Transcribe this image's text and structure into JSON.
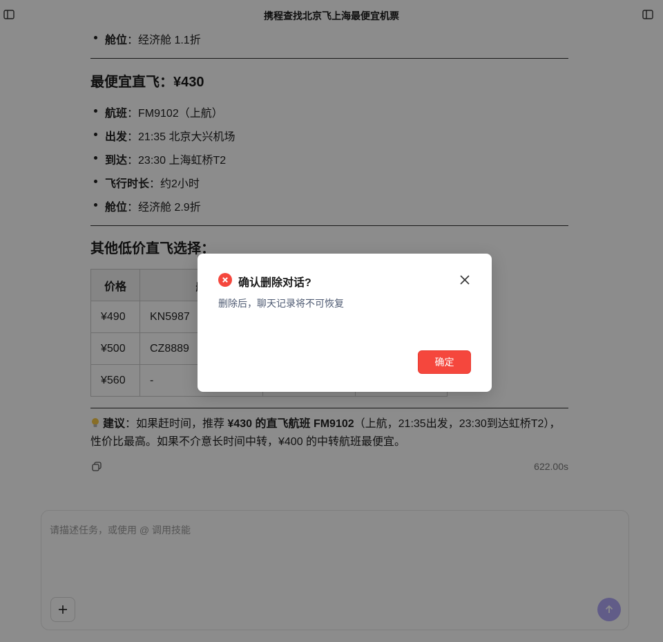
{
  "window": {
    "title": "携程查找北京飞上海最便宜机票",
    "left_icon": "sidebar-toggle-icon",
    "right_icon": "panel-toggle-icon"
  },
  "content": {
    "top_bullet": {
      "label": "舱位",
      "value": "：经济舱 1.1折"
    },
    "cheapest_heading": "最便宜直飞：¥430",
    "cheapest": [
      {
        "label": "航班",
        "value": "：FM9102（上航）"
      },
      {
        "label": "出发",
        "value": "：21:35 北京大兴机场"
      },
      {
        "label": "到达",
        "value": "：23:30 上海虹桥T2"
      },
      {
        "label": "飞行时长",
        "value": "：约2小时"
      },
      {
        "label": "舱位",
        "value": "：经济舱 2.9折"
      }
    ],
    "others_heading": "其他低价直飞选择：",
    "table": {
      "headers": [
        "价格",
        "航",
        "",
        ""
      ],
      "rows": [
        [
          "¥490",
          "KN5987",
          "",
          ""
        ],
        [
          "¥500",
          "CZ8889",
          "",
          ""
        ],
        [
          "¥560",
          "-",
          "",
          ""
        ]
      ]
    },
    "suggestion": {
      "icon": "lightbulb-icon",
      "label": "建议",
      "p1": "：如果赶时间，推荐 ",
      "bold": "¥430 的直飞航班 FM9102",
      "p2": "（上航，21:35出发，23:30到达虹桥T2），性价比最高。如果不介意长时间中转，¥400 的中转航班最便宜。"
    },
    "elapsed": "622.00s"
  },
  "composer": {
    "placeholder": "请描述任务，或使用 @ 调用技能",
    "accent": "#b1a8f8"
  },
  "dialog": {
    "title": "确认删除对话?",
    "description": "删除后，聊天记录将不可恢复",
    "confirm_label": "确定",
    "confirm_color": "#f5473d",
    "icon": "error-icon"
  }
}
